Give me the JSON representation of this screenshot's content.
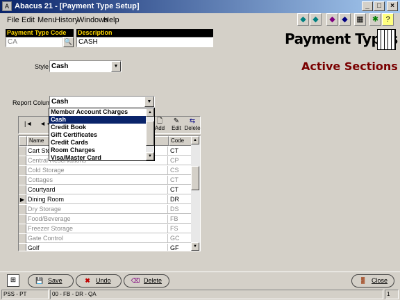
{
  "window": {
    "title": "Abacus 21 - [Payment Type Setup]",
    "app_icon": "app-icon",
    "min": "_",
    "max": "□",
    "close": "×"
  },
  "menu": [
    "File",
    "Edit",
    "Menu",
    "History",
    "Windows",
    "Help"
  ],
  "toolbar": {
    "prev": "◆",
    "next": "◆",
    "bookmark": "◆",
    "calc": "▦",
    "run": "✱",
    "help": "?"
  },
  "fields": {
    "payment_type_code_label": "Payment Type Code",
    "payment_type_code_value": "CA",
    "description_label": "Description",
    "description_value": "CASH"
  },
  "page_title": "Payment Types",
  "active_sections": "Active Sections",
  "style": {
    "label": "Style",
    "value": "Cash"
  },
  "report_column": {
    "label": "Report Column",
    "value": "Cash",
    "options": [
      "Member Account Charges",
      "Cash",
      "Credit Book",
      "Gift Certificates",
      "Credit Cards",
      "Room Charges",
      "Visa/Master Card"
    ],
    "selected": 1
  },
  "navigator": {
    "first": "|◄",
    "prev": "◄◄",
    "add": "Add",
    "edit": "Edit",
    "delete": "Delete"
  },
  "grid": {
    "columns": [
      "Name",
      "Code"
    ],
    "rows": [
      {
        "name": "Cart Storage",
        "code": "CT",
        "active": true,
        "current": false
      },
      {
        "name": "Central Reservations",
        "code": "CP",
        "active": false,
        "current": false
      },
      {
        "name": "Cold Storage",
        "code": "CS",
        "active": false,
        "current": false
      },
      {
        "name": "Cottages",
        "code": "CT",
        "active": false,
        "current": false
      },
      {
        "name": "Courtyard",
        "code": "CT",
        "active": true,
        "current": false
      },
      {
        "name": "Dining Room",
        "code": "DR",
        "active": true,
        "current": true
      },
      {
        "name": "Dry Storage",
        "code": "DS",
        "active": false,
        "current": false
      },
      {
        "name": "Food/Beverage",
        "code": "FB",
        "active": false,
        "current": false
      },
      {
        "name": "Freezer Storage",
        "code": "FS",
        "active": false,
        "current": false
      },
      {
        "name": "Gate Control",
        "code": "GC",
        "active": false,
        "current": false
      },
      {
        "name": "Golf",
        "code": "GF",
        "active": true,
        "current": false
      }
    ]
  },
  "buttons": {
    "save": "Save",
    "undo": "Undo",
    "delete": "Delete",
    "close": "Close"
  },
  "status": {
    "pane1": "PSS - PT",
    "pane2": "00 - FB - DR - QA",
    "pane3": "1"
  }
}
